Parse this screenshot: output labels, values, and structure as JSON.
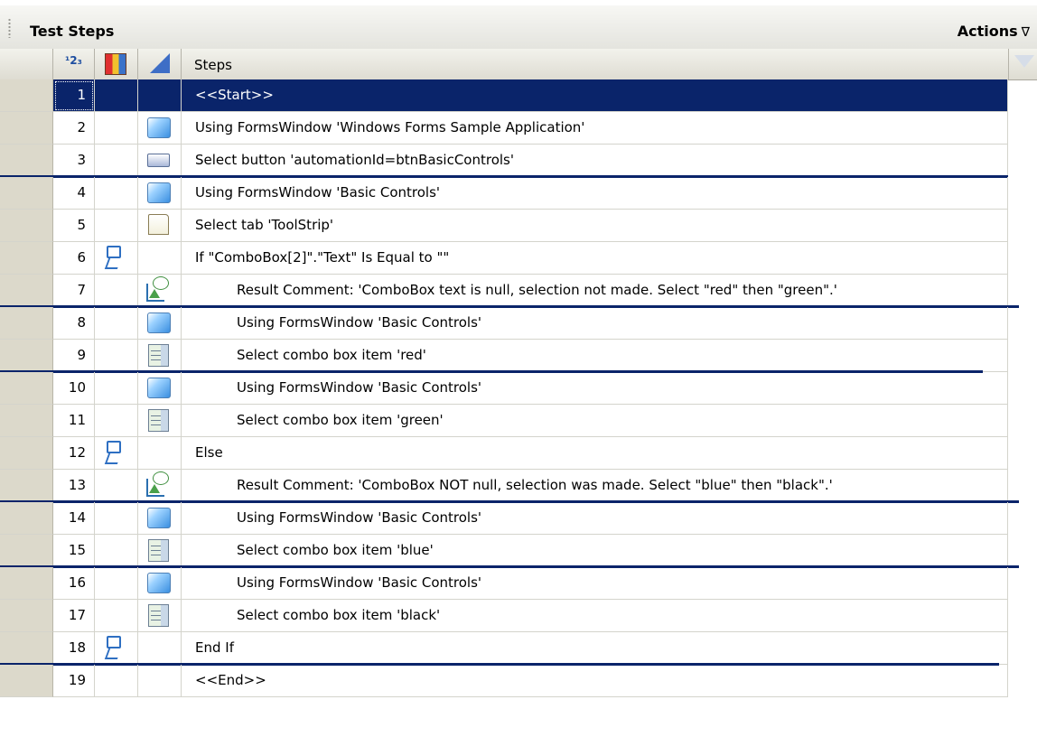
{
  "panel": {
    "title": "Test Steps",
    "actions_label": "Actions",
    "actions_chevron": "∇"
  },
  "columns": {
    "number_icon": "numbering-icon",
    "number_glyph": "¹2₃",
    "condition_icon": "cube-icon",
    "type_icon": "stair-icon",
    "steps_label": "Steps",
    "filter_icon": "filter-icon"
  },
  "rows": [
    {
      "num": "1",
      "type_icon": "",
      "cond_icon": "",
      "indent": 0,
      "text": "<<Start>>"
    },
    {
      "num": "2",
      "type_icon": "form-window-icon",
      "cond_icon": "",
      "indent": 0,
      "text": "Using FormsWindow 'Windows Forms Sample Application'"
    },
    {
      "num": "3",
      "type_icon": "button-icon",
      "cond_icon": "",
      "indent": 0,
      "text": "Select button 'automationId=btnBasicControls'"
    },
    {
      "num": "4",
      "type_icon": "form-window-icon",
      "cond_icon": "",
      "indent": 0,
      "text": "Using FormsWindow 'Basic Controls'"
    },
    {
      "num": "5",
      "type_icon": "tab-icon",
      "cond_icon": "",
      "indent": 0,
      "text": "Select tab 'ToolStrip'"
    },
    {
      "num": "6",
      "type_icon": "",
      "cond_icon": "condition-icon",
      "indent": 0,
      "text": "If \"ComboBox[2]\".\"Text\" Is Equal to \"\""
    },
    {
      "num": "7",
      "type_icon": "comment-icon",
      "cond_icon": "",
      "indent": 1,
      "text": "Result Comment: 'ComboBox text is null, selection not made. Select \"red\" then \"green\".'"
    },
    {
      "num": "8",
      "type_icon": "form-window-icon",
      "cond_icon": "",
      "indent": 1,
      "text": "Using FormsWindow 'Basic Controls'"
    },
    {
      "num": "9",
      "type_icon": "combo-box-icon",
      "cond_icon": "",
      "indent": 1,
      "text": "Select combo box item 'red'"
    },
    {
      "num": "10",
      "type_icon": "form-window-icon",
      "cond_icon": "",
      "indent": 1,
      "text": "Using FormsWindow 'Basic Controls'"
    },
    {
      "num": "11",
      "type_icon": "combo-box-icon",
      "cond_icon": "",
      "indent": 1,
      "text": "Select combo box item 'green'"
    },
    {
      "num": "12",
      "type_icon": "",
      "cond_icon": "condition-icon",
      "indent": 0,
      "text": "Else"
    },
    {
      "num": "13",
      "type_icon": "comment-icon",
      "cond_icon": "",
      "indent": 1,
      "text": "Result Comment: 'ComboBox NOT null, selection was made. Select \"blue\" then \"black\".'"
    },
    {
      "num": "14",
      "type_icon": "form-window-icon",
      "cond_icon": "",
      "indent": 1,
      "text": "Using FormsWindow 'Basic Controls'"
    },
    {
      "num": "15",
      "type_icon": "combo-box-icon",
      "cond_icon": "",
      "indent": 1,
      "text": "Select combo box item 'blue'"
    },
    {
      "num": "16",
      "type_icon": "form-window-icon",
      "cond_icon": "",
      "indent": 1,
      "text": "Using FormsWindow 'Basic Controls'"
    },
    {
      "num": "17",
      "type_icon": "combo-box-icon",
      "cond_icon": "",
      "indent": 1,
      "text": "Select combo box item 'black'"
    },
    {
      "num": "18",
      "type_icon": "",
      "cond_icon": "condition-icon",
      "indent": 0,
      "text": "End If"
    },
    {
      "num": "19",
      "type_icon": "",
      "cond_icon": "",
      "indent": 0,
      "text": "<<End>>"
    }
  ],
  "selected_row": "1",
  "colors": {
    "selection": "#0a246a",
    "row_selector": "#dcd9cb",
    "separator": "#0a246a"
  }
}
